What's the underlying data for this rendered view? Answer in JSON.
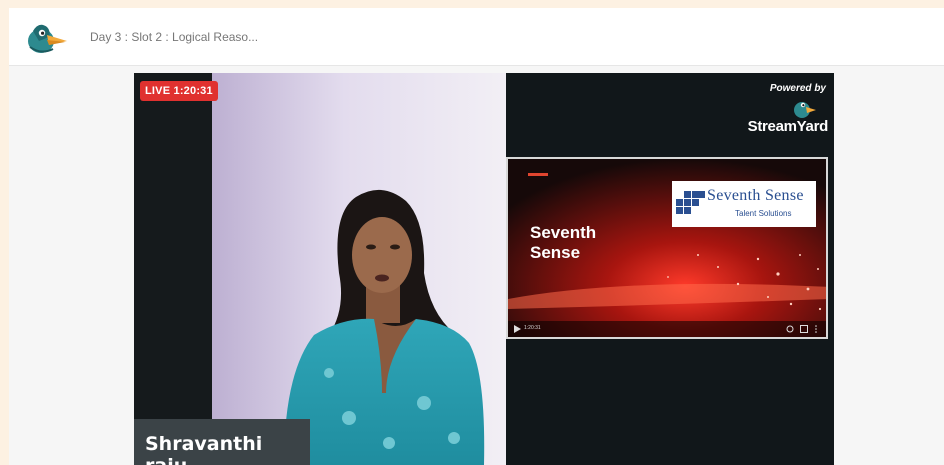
{
  "header": {
    "title": "Day 3 : Slot 2 : Logical Reaso..."
  },
  "stream": {
    "live_badge": "LIVE 1:20:31",
    "speaker_name": "Shravanthi raju",
    "powered_by": "Powered by",
    "brand": "StreamYard",
    "slide": {
      "logo_title": "Seventh Sense",
      "logo_subtitle": "Talent Solutions",
      "title_line1": "Seventh",
      "title_line2": "Sense",
      "time": "1:20:31"
    }
  },
  "colors": {
    "page_bg": "#fdf1e2",
    "live_red": "#e0312f",
    "stage_bg": "#11171a",
    "name_tag_bg": "#3b4347",
    "brand_blue": "#2a4f91"
  },
  "icons": [
    "duck-logo-icon",
    "streamyard-logo-icon",
    "play-icon",
    "fullscreen-icon",
    "settings-icon"
  ]
}
